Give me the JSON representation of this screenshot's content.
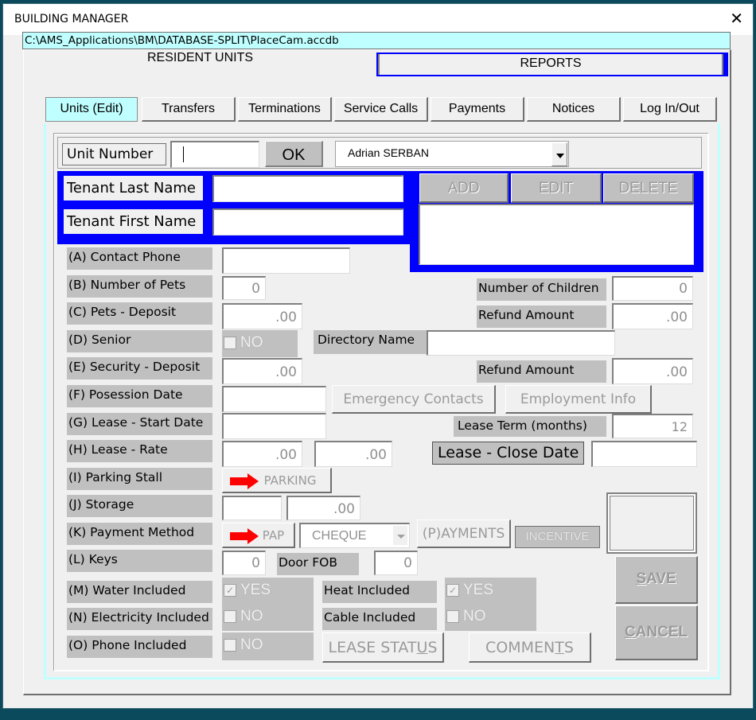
{
  "window": {
    "title": "BUILDING MANAGER",
    "close_icon": "close-icon"
  },
  "path": "C:\\AMS_Applications\\BM\\DATABASE-SPLIT\\PlaceCam.accdb",
  "main_tabs": [
    {
      "label": "RESIDENT UNITS",
      "active": true
    },
    {
      "label": "REPORTS",
      "active": false
    }
  ],
  "sub_tabs": [
    {
      "label": "Units (Edit)",
      "active": true
    },
    {
      "label": "Transfers"
    },
    {
      "label": "Terminations"
    },
    {
      "label": "Service Calls"
    },
    {
      "label": "Payments"
    },
    {
      "label": "Notices"
    },
    {
      "label": "Log In/Out"
    }
  ],
  "unit_bar": {
    "unit_number_label": "Unit Number",
    "unit_number_value": "",
    "ok_label": "OK",
    "user_combo_value": "Adrian SERBAN"
  },
  "tenant": {
    "last_name_label": "Tenant Last Name",
    "last_name_value": "",
    "first_name_label": "Tenant First Name",
    "first_name_value": ""
  },
  "occupants": {
    "add_label": "ADD",
    "edit_label": "EDIT",
    "delete_label": "DELETE"
  },
  "fields": {
    "a_label": "(A) Contact Phone",
    "a_value": "",
    "b_label": "(B) Number of Pets",
    "b_value": "0",
    "c_label": "(C) Pets - Deposit",
    "c_value": ".00",
    "d_label": "(D) Senior",
    "d_value": "NO",
    "d_checked": false,
    "e_label": "(E) Security - Deposit",
    "e_value": ".00",
    "f_label": "(F) Posession Date",
    "f_value": "",
    "g_label": "(G) Lease - Start Date",
    "g_value": "",
    "h_label": "(H) Lease - Rate",
    "h_value1": ".00",
    "h_value2": ".00",
    "i_label": "(I) Parking Stall",
    "i_button": "PARKING",
    "j_label": "(J) Storage",
    "j_value1": "",
    "j_value2": ".00",
    "k_label": "(K) Payment Method",
    "k_pap_button": "PAP",
    "k_method_value": "CHEQUE",
    "k_payments_button": "(P)AYMENTS",
    "k_incentive_button": "INCENTIVE",
    "l_label": "(L) Keys",
    "l_value": "0",
    "door_fob_label": "Door FOB",
    "door_fob_value": "0",
    "m_label": "(M) Water Included",
    "m_value": "YES",
    "m_checked": true,
    "n_label": "(N) Electricity Included",
    "n_value": "NO",
    "n_checked": false,
    "o_label": "(O) Phone Included",
    "o_value": "NO",
    "o_checked": false
  },
  "right_fields": {
    "children_label": "Number of Children",
    "children_value": "0",
    "refund1_label": "Refund Amount",
    "refund1_value": ".00",
    "directory_label": "Directory Name",
    "directory_value": "",
    "refund2_label": "Refund Amount",
    "refund2_value": ".00",
    "emergency_button": "Emergency Contacts",
    "employment_button": "Employment Info",
    "lease_term_label": "Lease Term (months)",
    "lease_term_value": "12",
    "close_date_label": "Lease - Close Date",
    "close_date_value": "",
    "heat_label": "Heat Included",
    "heat_value": "YES",
    "heat_checked": true,
    "cable_label": "Cable Included",
    "cable_value": "NO",
    "cable_checked": false
  },
  "actions": {
    "lease_status_pre": "LEASE STAT",
    "lease_status_u": "U",
    "lease_status_post": "S",
    "comments_pre": "COMMEN",
    "comments_u": "T",
    "comments_post": "S",
    "save_u": "S",
    "save_post": "AVE",
    "cancel_u": "C",
    "cancel_post": "ANCEL"
  },
  "colors": {
    "accent_blue": "#0000ff",
    "cyan": "#c0ffff",
    "arrow_red": "#ff0000"
  }
}
